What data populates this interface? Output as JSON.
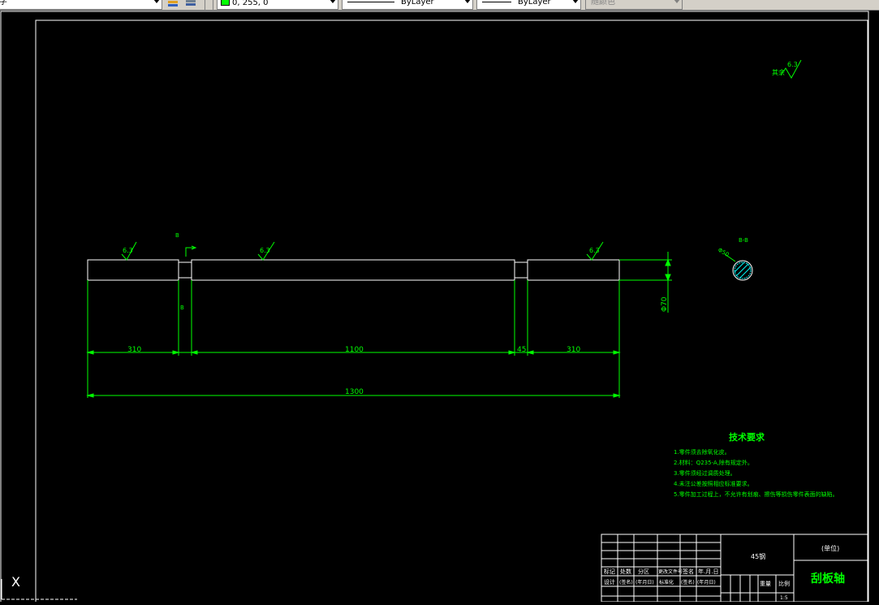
{
  "toolbar": {
    "style_text": "字",
    "color_value": "0, 255, 0",
    "color_swatch": "#00ff00",
    "linetype": "ByLayer",
    "lineweight": "ByLayer",
    "plotstyle": "随颜色"
  },
  "colors": {
    "background": "#000000",
    "geometry": "#ffffff",
    "annotation": "#00ff00",
    "section_hatch": "#00ffff"
  },
  "drawing": {
    "roughness_global": "6.3",
    "roughness_global_label": "其余",
    "roughness_marks": [
      "6.3",
      "6.3",
      "6.3"
    ],
    "section_mark_top": "B",
    "section_mark_bottom": "B",
    "section_title": "B-B",
    "section_dim": "Φ50",
    "dim_diameter": "Φ70",
    "dims": [
      "310",
      "1100",
      "45",
      "310"
    ],
    "dim_total": "1300"
  },
  "tech_requirements": {
    "title": "技术要求",
    "items": [
      "1.零件须去除氧化皮。",
      "2.材料：Q235-A,除有规定外。",
      "3.零件须经过调质处理。",
      "4.未注公差按照相应标准要求。",
      "5.零件加工过程上，不允许有划痕、擦伤等损伤零件表面的缺陷。"
    ]
  },
  "title_block": {
    "row_labels": [
      "标记",
      "处数",
      "分区",
      "更改文件号",
      "签名",
      "年.月.日"
    ],
    "row_labels2": [
      "设计",
      "(签名)",
      "(年月日)",
      "标准化",
      "(签名)",
      "(年月日)"
    ],
    "material": "45钢",
    "unit": "(单位)",
    "part_name": "刮板轴",
    "weight_label": "重量",
    "scale_label": "比例",
    "scale": "1:5"
  },
  "ucs_label": "X"
}
